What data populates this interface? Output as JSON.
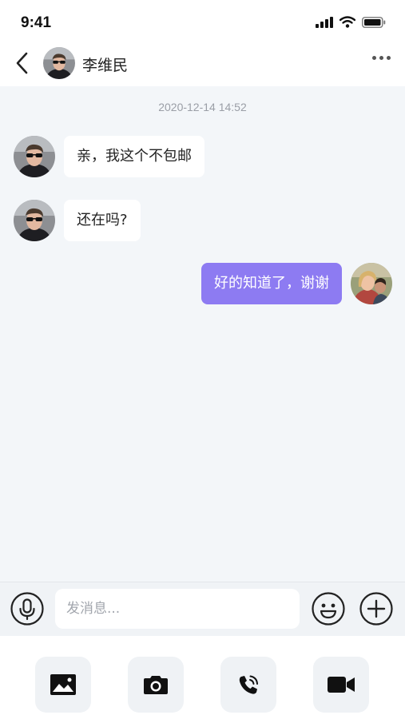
{
  "status_bar": {
    "time": "9:41"
  },
  "header": {
    "contact_name": "李维民"
  },
  "chat": {
    "timestamp": "2020-12-14   14:52",
    "messages": [
      {
        "side": "incoming",
        "text": "亲，我这个不包邮"
      },
      {
        "side": "incoming",
        "text": "还在吗?"
      },
      {
        "side": "outgoing",
        "text": "好的知道了，谢谢"
      }
    ]
  },
  "input": {
    "placeholder": "发消息...",
    "value": ""
  },
  "toolbar": {
    "items": [
      "image-icon",
      "camera-icon",
      "voice-call-icon",
      "video-call-icon"
    ]
  },
  "colors": {
    "outgoing_bubble": "#8d7bf2",
    "chat_background": "#f3f6f9"
  }
}
